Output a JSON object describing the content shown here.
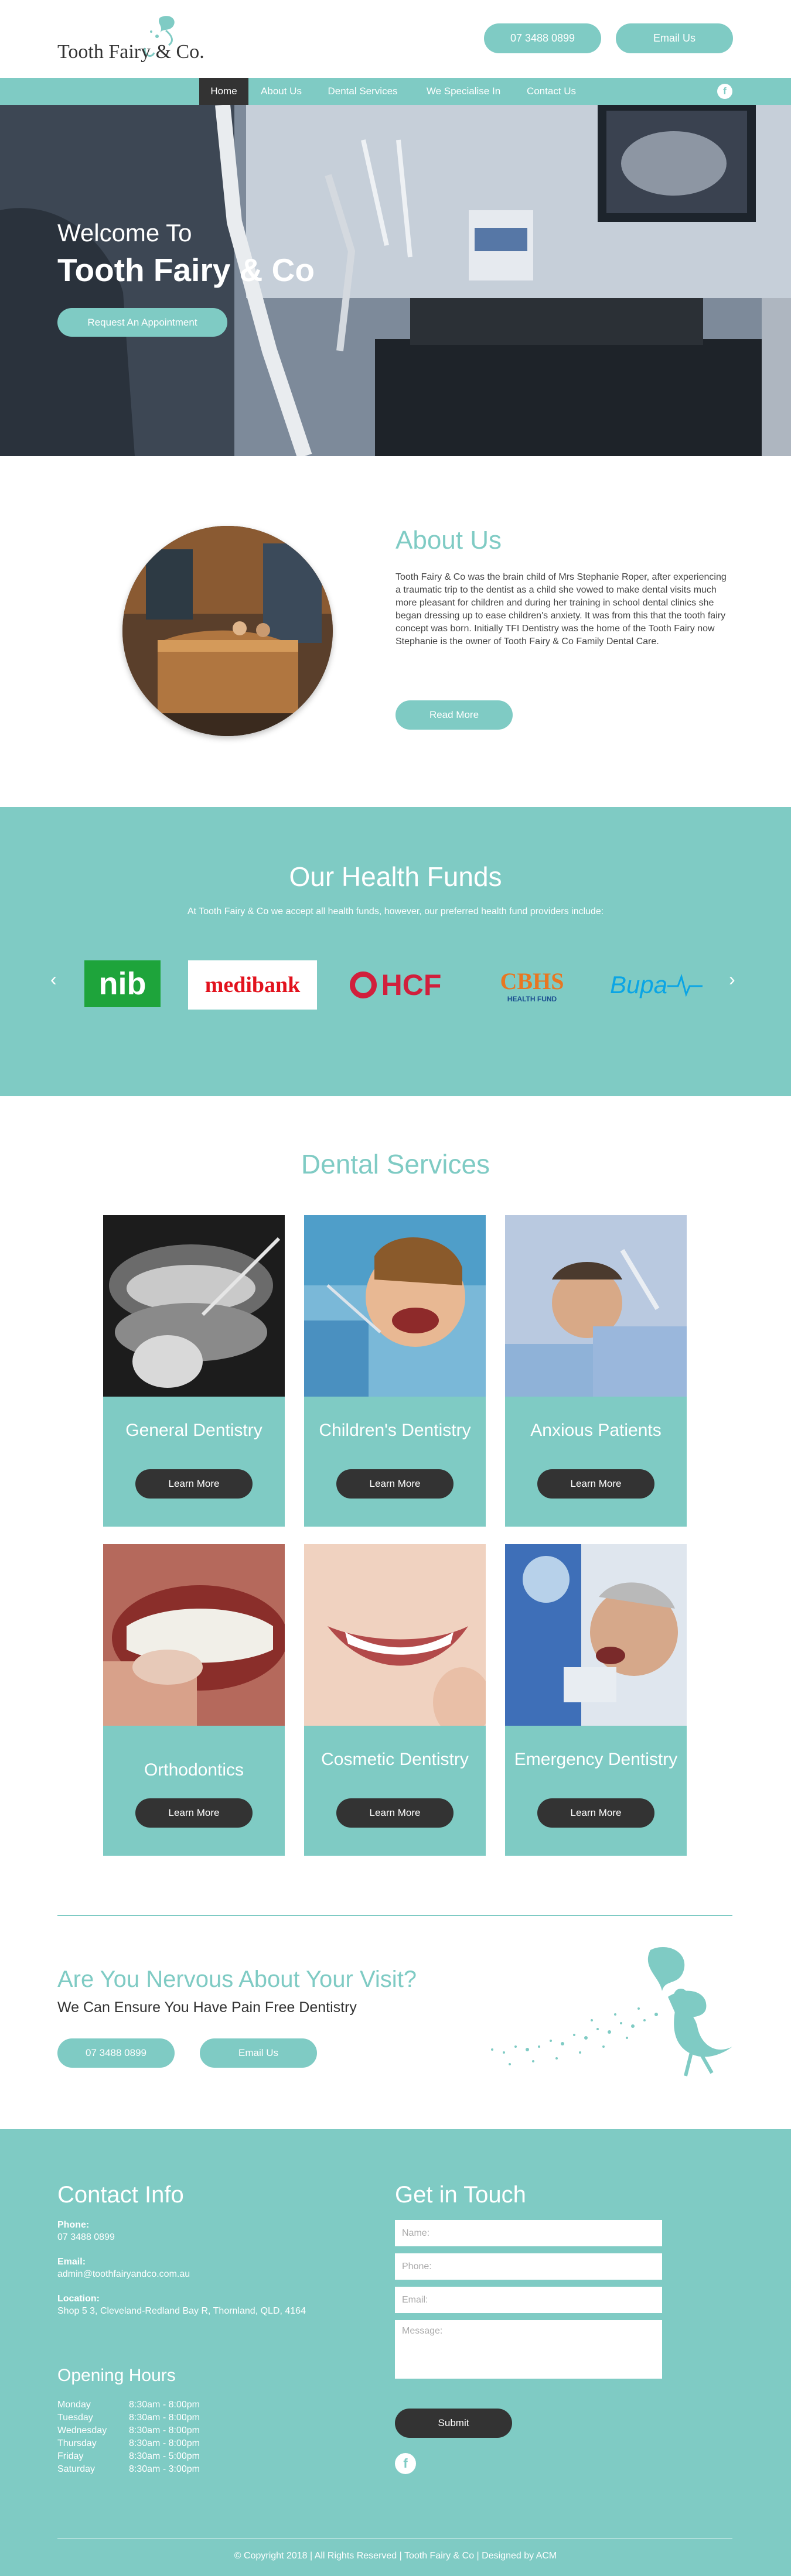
{
  "header": {
    "logo_text": "Tooth Fairy & Co.",
    "phone_button": "07 3488 0899",
    "email_button": "Email Us"
  },
  "nav": {
    "items": [
      {
        "label": "Home",
        "active": true
      },
      {
        "label": "About Us",
        "active": false
      },
      {
        "label": "Dental Services",
        "active": false
      },
      {
        "label": "We Specialise In",
        "active": false
      },
      {
        "label": "Contact Us",
        "active": false
      }
    ],
    "social_icon": "facebook-icon"
  },
  "hero": {
    "line1": "Welcome To",
    "line2": "Tooth Fairy & Co",
    "button": "Request An Appointment"
  },
  "about": {
    "title": "About Us",
    "text": "Tooth Fairy & Co was the brain child of Mrs Stephanie Roper, after experiencing a traumatic trip to the dentist as a child she vowed to make dental visits much more pleasant for children and during her training in school dental clinics she began dressing up to ease children's anxiety. It was from this that the tooth fairy concept was born. Initially TFI Dentistry was the home of the Tooth Fairy now Stephanie is the owner of Tooth Fairy & Co Family Dental Care.",
    "button": "Read More"
  },
  "funds": {
    "title": "Our Health Funds",
    "subtitle": "At Tooth Fairy & Co we accept all health funds, however, our preferred health fund providers include:",
    "logos": [
      {
        "text": "nib"
      },
      {
        "text": "medibank"
      },
      {
        "text": "HCF"
      },
      {
        "text": "CBHS",
        "subtext": "HEALTH FUND"
      },
      {
        "text": "Bupa"
      }
    ],
    "colors": {
      "nib_bg": "#1ea43b",
      "medibank_text": "#e2121d",
      "hcf_text": "#d11f3c",
      "cbhs_text": "#e87722",
      "bupa_text": "#0aa5e5"
    }
  },
  "services": {
    "title": "Dental Services",
    "cards": [
      {
        "title": "General Dentistry",
        "button": "Learn More"
      },
      {
        "title": "Children's Dentistry",
        "button": "Learn More"
      },
      {
        "title": "Anxious Patients",
        "button": "Learn More"
      },
      {
        "title": "Orthodontics",
        "button": "Learn More"
      },
      {
        "title": "Cosmetic Dentistry",
        "button": "Learn More"
      },
      {
        "title": "Emergency Dentistry",
        "button": "Learn More"
      }
    ]
  },
  "nervous": {
    "title": "Are You Nervous About Your Visit?",
    "subtitle": "We Can Ensure You Have Pain Free Dentistry",
    "phone_button": "07 3488 0899",
    "email_button": "Email Us"
  },
  "footer": {
    "contact_title": "Contact Info",
    "phone_label": "Phone:",
    "phone": "07 3488 0899",
    "email_label": "Email:",
    "email": "admin@toothfairyandco.com.au",
    "location_label": "Location:",
    "location": "Shop 5 3, Cleveland-Redland Bay R, Thornland, QLD, 4164",
    "hours_title": "Opening Hours",
    "hours": [
      {
        "day": "Monday",
        "time": "8:30am - 8:00pm"
      },
      {
        "day": "Tuesday",
        "time": "8:30am - 8:00pm"
      },
      {
        "day": "Wednesday",
        "time": "8:30am - 8:00pm"
      },
      {
        "day": "Thursday",
        "time": "8:30am - 8:00pm"
      },
      {
        "day": "Friday",
        "time": "8:30am - 5:00pm"
      },
      {
        "day": "Saturday",
        "time": "8:30am - 3:00pm"
      }
    ],
    "form_title": "Get in Touch",
    "form": {
      "name_placeholder": "Name:",
      "phone_placeholder": "Phone:",
      "email_placeholder": "Email:",
      "message_placeholder": "Message:",
      "submit": "Submit"
    },
    "copyright": "© Copyright 2018 | All Rights Reserved | Tooth Fairy & Co | Designed by ACM"
  },
  "colors": {
    "accent": "#7fcbc4",
    "dark": "#333333",
    "white": "#ffffff"
  }
}
